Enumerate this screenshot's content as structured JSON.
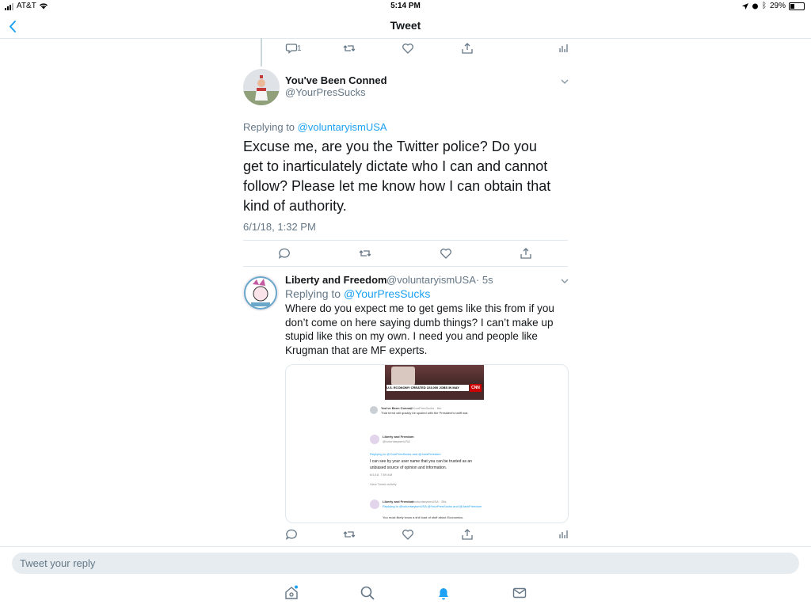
{
  "status_bar": {
    "carrier": "AT&T",
    "time": "5:14 PM",
    "battery": "29%"
  },
  "nav": {
    "title": "Tweet"
  },
  "prev_tweet": {
    "reply_count": "1"
  },
  "main_tweet": {
    "author_name": "You've Been Conned",
    "author_handle": "@YourPresSucks",
    "replying_prefix": "Replying to",
    "replying_to": "@voluntaryismUSA",
    "text": "Excuse me, are you the Twitter police? Do you get to inarticulately dictate who I can and cannot follow? Please let me know how I can obtain that kind of authority.",
    "datetime": "6/1/18, 1:32 PM"
  },
  "reply_tweet": {
    "author_name": "Liberty and Freedom",
    "author_handle": "@voluntaryismUSA",
    "time": "· 5s",
    "replying_prefix": "Replying to",
    "replying_to": "@YourPresSucks",
    "text": "Where do you expect me to get gems like this from if you don’t come on here saying dumb things? I can’t make up stupid like this on my own. I need you and people like Krugman that are MF experts.",
    "media": {
      "chyron": "U.S. ECONOMY CREATED 223,000 JOBS IN MAY",
      "network": "CNN",
      "t1_name": "You've Been Conned",
      "t1_handle": "@YourPresSucks · 8m",
      "t1_text": "That trend will quickly be spoiled with the President's tariff war.",
      "t2_name": "Liberty and Freedom",
      "t2_handle": "@voluntaryismUSA",
      "t2_replying": "Replying to @YourPresSucks and @JackFreedom",
      "t2_text": "I can see by your user name that you can be trusted as an unbiased source of opinion and information.",
      "t2_date": "6/1/18, 7:59 AM",
      "t2_activity": "View Tweet activity",
      "t3_name": "Liberty and Freedom",
      "t3_handle": "@voluntaryismUSA · 28s",
      "t3_replying": "Replying to @voluntaryismUSA @YourPresSucks and @JackFreedom",
      "t3_text": "You most likely know a shit load of stuff about Economics."
    }
  },
  "composer": {
    "placeholder": "Tweet your reply"
  },
  "icons": {
    "back": "chevron-left-icon",
    "reply": "reply-icon",
    "retweet": "retweet-icon",
    "like": "heart-icon",
    "share": "share-icon",
    "analytics": "analytics-icon",
    "home": "home-icon",
    "search": "search-icon",
    "notifications": "bell-icon",
    "messages": "mail-icon"
  },
  "colors": {
    "accent": "#1da1f2",
    "muted": "#657786",
    "divider": "#e1e8ed"
  }
}
